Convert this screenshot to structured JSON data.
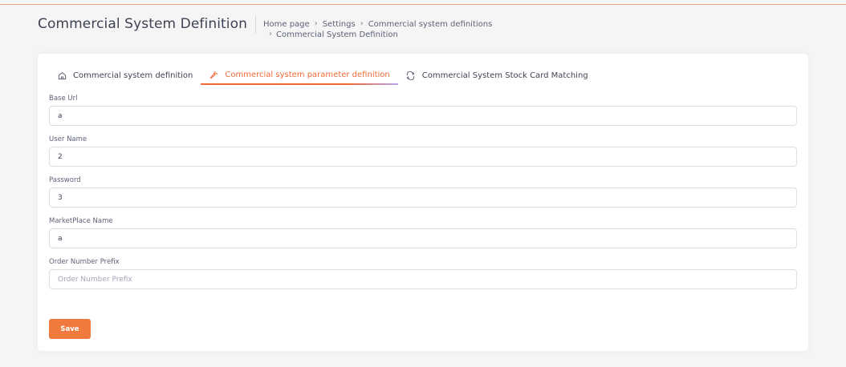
{
  "page": {
    "title": "Commercial System Definition",
    "breadcrumb": [
      "Home page",
      "Settings",
      "Commercial system definitions",
      "Commercial System Definition"
    ]
  },
  "tabs": [
    {
      "label": "Commercial system definition",
      "icon": "home-icon",
      "active": false
    },
    {
      "label": "Commercial system parameter definition",
      "icon": "wrench-icon",
      "active": true
    },
    {
      "label": "Commercial System Stock Card Matching",
      "icon": "swap-arrows-icon",
      "active": false
    }
  ],
  "form": {
    "fields": [
      {
        "label": "Base Url",
        "value": "a",
        "placeholder": ""
      },
      {
        "label": "User Name",
        "value": "2",
        "placeholder": ""
      },
      {
        "label": "Password",
        "value": "3",
        "placeholder": ""
      },
      {
        "label": "MarketPlace Name",
        "value": "a",
        "placeholder": ""
      },
      {
        "label": "Order Number Prefix",
        "value": "",
        "placeholder": "Order Number Prefix"
      }
    ],
    "save_label": "Save"
  },
  "colors": {
    "accent": "#f16936",
    "save_button": "#f07a3d",
    "tab_gradient_end": "#b9a6f0"
  }
}
